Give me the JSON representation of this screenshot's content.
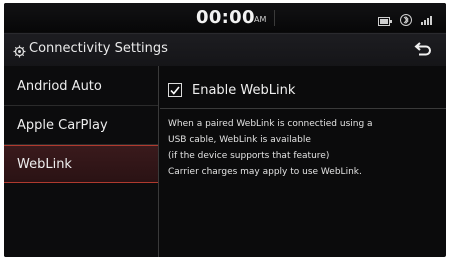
{
  "status_bar": {
    "time": "00:00",
    "ampm": "AM"
  },
  "header": {
    "title": "Connectivity Settings",
    "back_icon": "back-arrow-icon"
  },
  "sidebar": {
    "items": [
      {
        "label": "Andriod Auto",
        "active": false
      },
      {
        "label": "Apple CarPlay",
        "active": false
      },
      {
        "label": "WebLink",
        "active": true
      }
    ]
  },
  "content": {
    "checkbox": {
      "label": "Enable WebLink",
      "checked": true
    },
    "description": [
      "When a paired WebLink is connectied using a",
      "USB cable, WebLink is available",
      "(if the device supports that feature)",
      "Carrier charges may apply to use WebLink."
    ]
  },
  "colors": {
    "background": "#0b0b0c",
    "accent": "#b03a2e",
    "text": "#e9e9e9"
  }
}
